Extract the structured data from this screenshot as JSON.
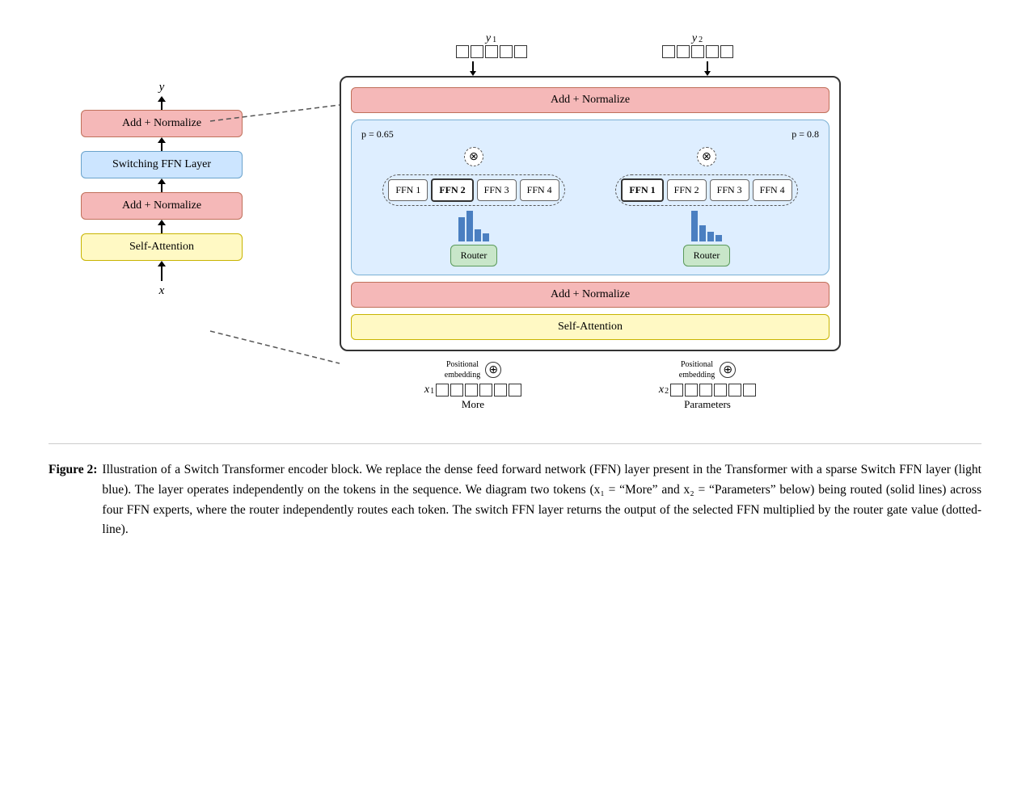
{
  "left_diagram": {
    "y_label": "y",
    "x_label": "x",
    "add_normalize_top": "Add + Normalize",
    "switching_ffn": "Switching FFN Layer",
    "add_normalize_bottom": "Add + Normalize",
    "self_attention": "Self-Attention"
  },
  "right_diagram": {
    "output_y1_label": "y",
    "output_y1_sub": "1",
    "output_y2_label": "y",
    "output_y2_sub": "2",
    "add_normalize_top": "Add + Normalize",
    "ffn_labels": [
      "FFN 1",
      "FFN 2",
      "FFN 3",
      "FFN 4"
    ],
    "p_left": "p = 0.65",
    "p_right": "p = 0.8",
    "router_label": "Router",
    "add_normalize_bottom": "Add + Normalize",
    "self_attention": "Self-Attention",
    "pos_embed_label": "Positional\nembedding",
    "x1_label": "x",
    "x1_sub": "1",
    "x2_label": "x",
    "x2_sub": "2",
    "more_label": "More",
    "params_label": "Parameters"
  },
  "caption": {
    "figure_label": "Figure 2:",
    "text": "Illustration of a Switch Transformer encoder block.  We replace the dense feed forward network (FFN) layer present in the Transformer with a sparse Switch FFN layer (light blue).  The layer operates independently on the tokens in the sequence.  We diagram two tokens (x₁ = “More” and x₂ = “Parameters” below) being routed (solid lines) across four FFN experts, where the router independently routes each token.  The switch FFN layer returns the output of the selected FFN multiplied by the router gate value (dotted-line)."
  }
}
